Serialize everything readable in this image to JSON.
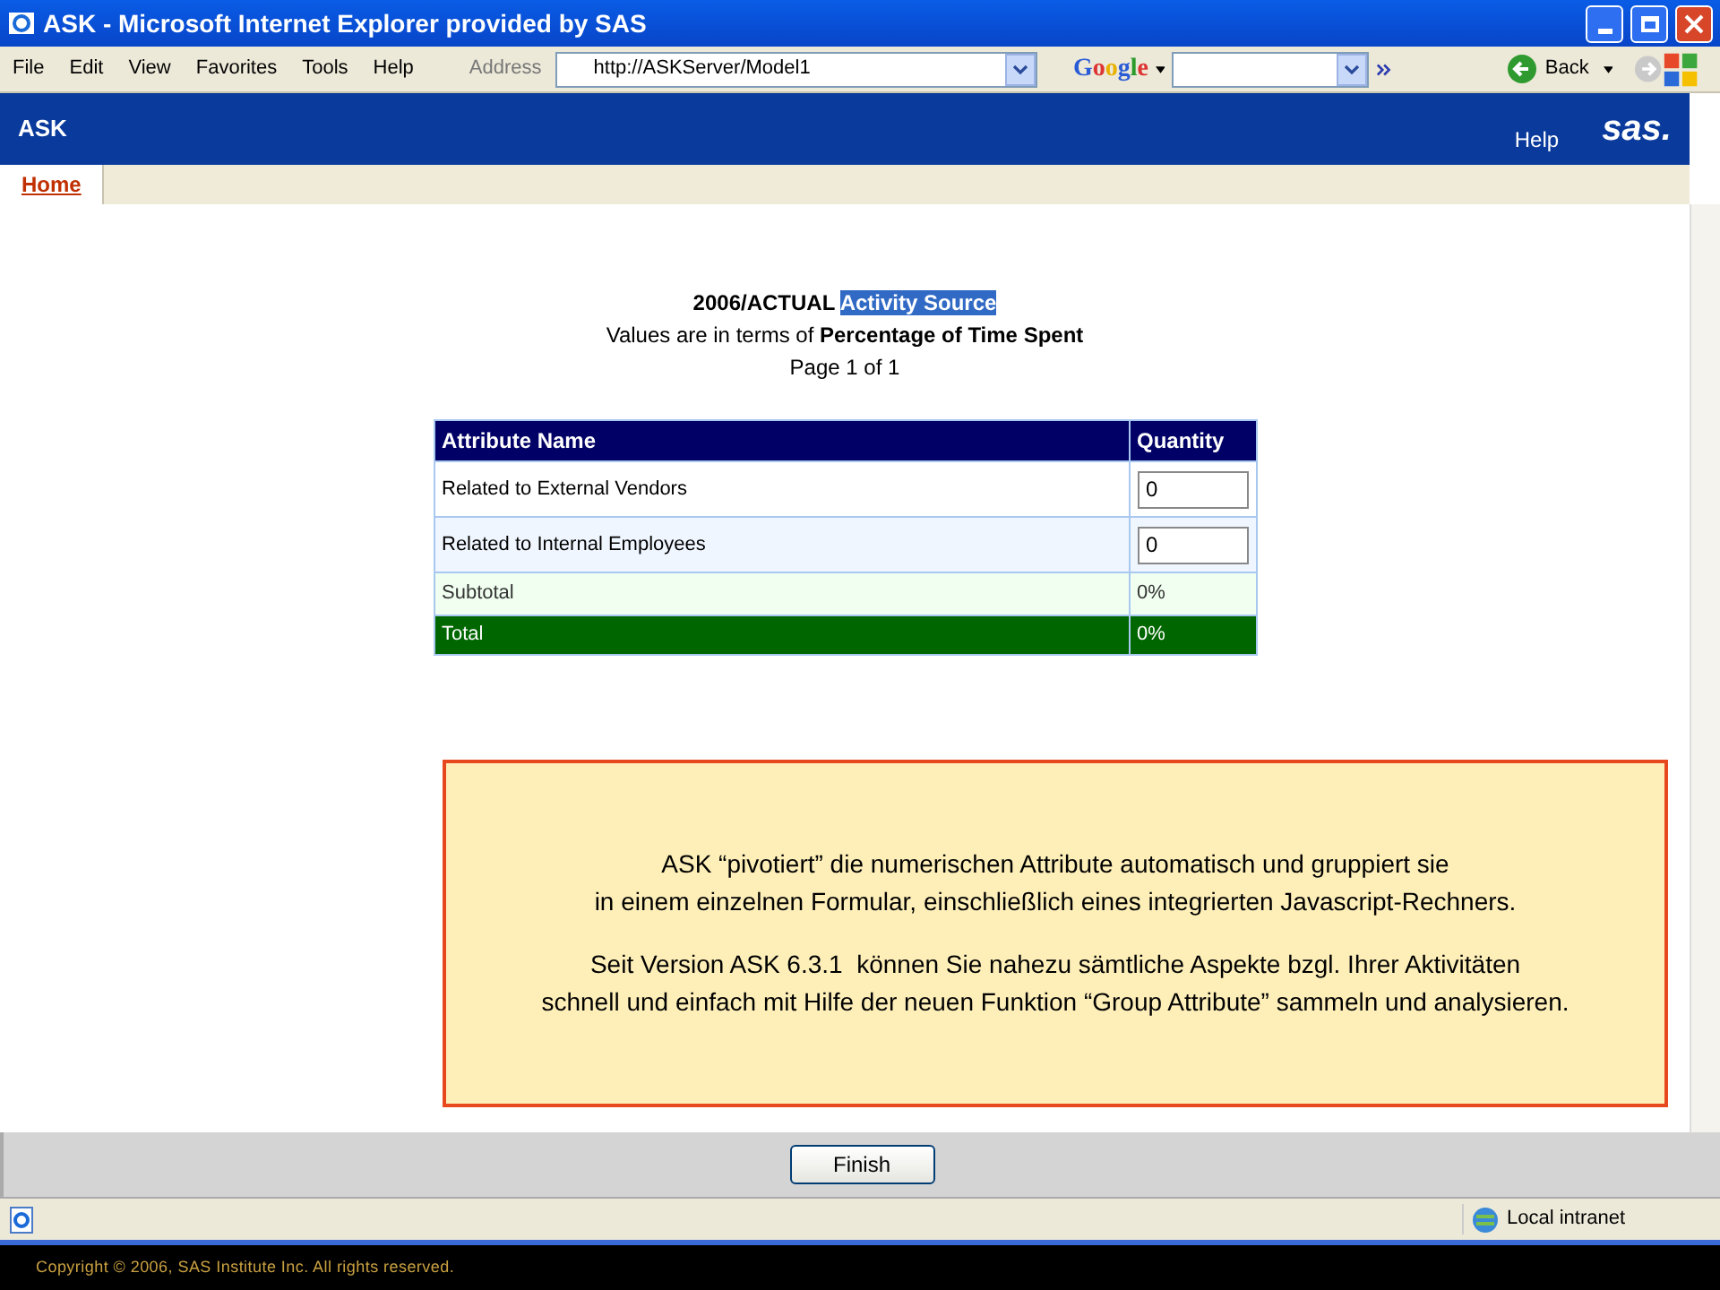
{
  "window": {
    "title": "ASK - Microsoft Internet Explorer provided by SAS"
  },
  "menu": [
    "File",
    "Edit",
    "View",
    "Favorites",
    "Tools",
    "Help"
  ],
  "address": {
    "label": "Address",
    "value": "http://ASKServer/Model1"
  },
  "google": {
    "label": "Google"
  },
  "nav": {
    "back": "Back"
  },
  "app": {
    "title": "ASK",
    "help": "Help",
    "brand": "sas."
  },
  "tabs": [
    {
      "label": "Home",
      "selected": true
    }
  ],
  "report": {
    "title": "2006/ACTUAL",
    "highlight": "Activity Source",
    "subtitle": "Values are in terms of **Percentage of Time Spent**",
    "page": "Page 1 of 1"
  },
  "table": {
    "columns": [
      "Attribute Name",
      "Quantity"
    ],
    "rows": [
      {
        "kind": "input",
        "name": "Related to External Vendors",
        "value": "0"
      },
      {
        "kind": "input",
        "name": "Related to Internal Employees",
        "value": "0"
      },
      {
        "kind": "subtotal",
        "name": "Subtotal",
        "value": "0%"
      },
      {
        "kind": "total",
        "name": "Total",
        "value": "0%"
      }
    ]
  },
  "callout": {
    "paragraphs": [
      [
        "ASK “pivotiert” die numerischen Attribute automatisch und gruppiert sie",
        "in einem einzelnen Formular, einschließlich eines integrierten Javascript-Rechners."
      ],
      [
        "Seit Version ASK 6.3.1  können Sie nahezu sämtliche Aspekte bzgl. Ihrer Aktivitäten",
        "schnell und einfach mit Hilfe der neuen Funktion “Group Attribute” sammeln und analysieren."
      ]
    ]
  },
  "finish": "Finish",
  "status": {
    "zone": "Local intranet"
  },
  "footer": "Copyright © 2006, SAS Institute Inc. All rights reserved."
}
